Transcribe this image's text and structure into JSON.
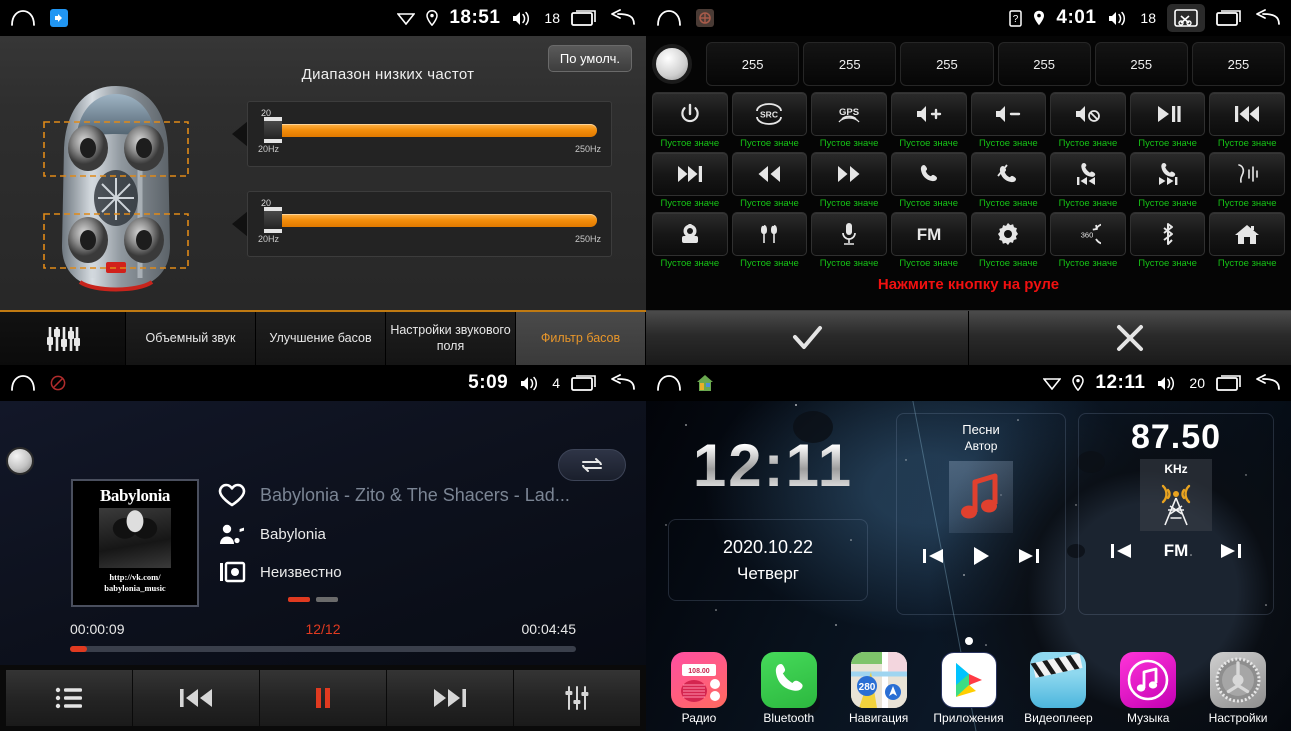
{
  "panel_eq": {
    "status": {
      "time": "18:51",
      "volume": "18"
    },
    "default_button": "По умолч.",
    "title": "Диапазон низких частот",
    "sliders": [
      {
        "value": "20",
        "min_label": "20Hz",
        "max_label": "250Hz",
        "fill_percent": 100
      },
      {
        "value": "20",
        "min_label": "20Hz",
        "max_label": "250Hz",
        "fill_percent": 100
      }
    ],
    "tabs": [
      {
        "label": "",
        "icon": "equalizer-icon",
        "active": false
      },
      {
        "label": "Объемный звук",
        "active": false
      },
      {
        "label": "Улучшение басов",
        "active": false
      },
      {
        "label": "Настройки звукового поля",
        "active": false
      },
      {
        "label": "Фильтр басов",
        "active": true
      }
    ]
  },
  "panel_swc": {
    "status": {
      "time": "4:01",
      "volume": "18"
    },
    "value_boxes": [
      "255",
      "255",
      "255",
      "255",
      "255",
      "255"
    ],
    "buttons": [
      {
        "icon": "power-icon",
        "label": "Пустое значе"
      },
      {
        "icon": "src-icon",
        "label": "Пустое значе"
      },
      {
        "icon": "gps-icon",
        "label": "Пустое значе"
      },
      {
        "icon": "volume-up-icon",
        "label": "Пустое значе"
      },
      {
        "icon": "volume-down-icon",
        "label": "Пустое значе"
      },
      {
        "icon": "volume-mute-icon",
        "label": "Пустое значе"
      },
      {
        "icon": "play-pause-icon",
        "label": "Пустое значе"
      },
      {
        "icon": "previous-track-icon",
        "label": "Пустое значе"
      },
      {
        "icon": "next-track-icon",
        "label": "Пустое значе"
      },
      {
        "icon": "rewind-icon",
        "label": "Пустое значе"
      },
      {
        "icon": "fast-forward-icon",
        "label": "Пустое значе"
      },
      {
        "icon": "phone-answer-icon",
        "label": "Пустое значе"
      },
      {
        "icon": "phone-hangup-icon",
        "label": "Пустое значе"
      },
      {
        "icon": "phone-prev-icon",
        "label": "Пустое значе"
      },
      {
        "icon": "phone-next-icon",
        "label": "Пустое значе"
      },
      {
        "icon": "voice-wave-icon",
        "label": "Пустое значе"
      },
      {
        "icon": "camera-icon",
        "label": "Пустое значе"
      },
      {
        "icon": "dual-zone-icon",
        "label": "Пустое значе"
      },
      {
        "icon": "microphone-icon",
        "label": "Пустое значе"
      },
      {
        "icon": "fm-icon",
        "label": "Пустое значе"
      },
      {
        "icon": "gear-icon",
        "label": "Пустое значе"
      },
      {
        "icon": "360-view-icon",
        "label": "Пустое значе"
      },
      {
        "icon": "bluetooth-icon",
        "label": "Пустое значе"
      },
      {
        "icon": "home-icon",
        "label": "Пустое значе"
      }
    ],
    "hint": "Нажмите кнопку на руле",
    "confirm_icon": "checkmark-icon",
    "cancel_icon": "close-icon"
  },
  "panel_player": {
    "status": {
      "time": "5:09",
      "volume": "4"
    },
    "album_art": {
      "title": "Babylonia",
      "url_line1": "http://vk.com/",
      "url_line2": "babylonia_music"
    },
    "track_title": "Babylonia - Zito & The Shacers - Lad...",
    "artist": "Babylonia",
    "album": "Неизвестно",
    "elapsed": "00:00:09",
    "track_counter": "12/12",
    "duration": "00:04:45",
    "progress_percent": 3,
    "controls": [
      {
        "icon": "playlist-icon"
      },
      {
        "icon": "previous-track-icon"
      },
      {
        "icon": "pause-icon"
      },
      {
        "icon": "next-track-icon"
      },
      {
        "icon": "equalizer-icon"
      }
    ],
    "repeat_icon": "repeat-icon"
  },
  "panel_home": {
    "status": {
      "time": "12:11",
      "volume": "20"
    },
    "clock": "12:11",
    "date": "2020.10.22",
    "weekday": "Четверг",
    "music_widget": {
      "song": "Песни",
      "artist": "Автор",
      "icon": "music-note-icon"
    },
    "radio_widget": {
      "frequency": "87.50",
      "unit": "KHz",
      "band": "FM",
      "icon": "radio-tower-icon"
    },
    "dock": [
      {
        "label": "Радио",
        "icon": "radio-app-icon"
      },
      {
        "label": "Bluetooth",
        "icon": "phone-app-icon"
      },
      {
        "label": "Навигация",
        "icon": "maps-app-icon"
      },
      {
        "label": "Приложения",
        "icon": "play-store-icon"
      },
      {
        "label": "Видеоплеер",
        "icon": "video-app-icon"
      },
      {
        "label": "Музыка",
        "icon": "music-app-icon"
      },
      {
        "label": "Настройки",
        "icon": "settings-app-icon"
      }
    ]
  },
  "colors": {
    "accent_orange": "#e8962a",
    "accent_red": "#e03a20",
    "label_green": "#16c416"
  }
}
